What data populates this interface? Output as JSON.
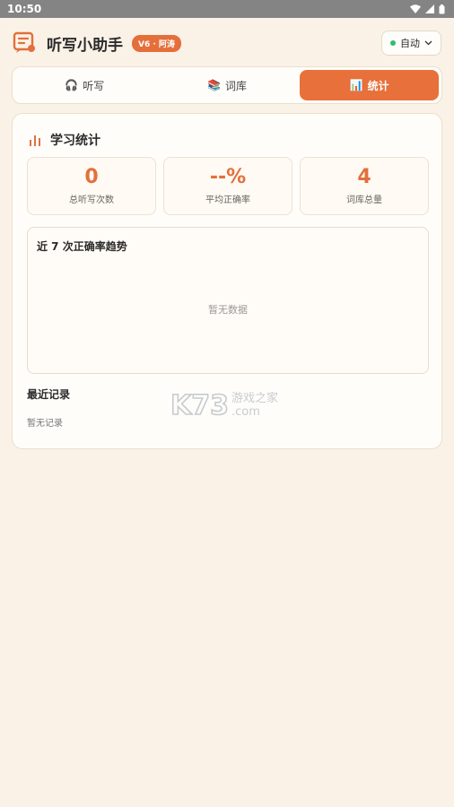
{
  "status_bar": {
    "time": "10:50"
  },
  "header": {
    "title": "听写小助手",
    "version_badge": "V6 · 阿涛",
    "mode_label": "自动"
  },
  "tabs": [
    {
      "icon": "headphones-icon",
      "glyph": "🎧",
      "label": "听写"
    },
    {
      "icon": "books-icon",
      "glyph": "📚",
      "label": "词库"
    },
    {
      "icon": "bar-chart-icon",
      "glyph": "📊",
      "label": "统计",
      "active": true
    }
  ],
  "stats_card": {
    "title": "学习统计",
    "stats": [
      {
        "value": "0",
        "label": "总听写次数"
      },
      {
        "value": "--%",
        "label": "平均正确率"
      },
      {
        "value": "4",
        "label": "词库总量"
      }
    ],
    "trend": {
      "title": "近 7 次正确率趋势",
      "empty_text": "暂无数据"
    },
    "records": {
      "title": "最近记录",
      "empty_text": "暂无记录"
    }
  },
  "watermark": {
    "brand": "K73",
    "sub": "游戏之家",
    "domain": ".com"
  },
  "colors": {
    "accent": "#e8703a",
    "background": "#faf2e6",
    "status_green": "#2dbd6e"
  }
}
